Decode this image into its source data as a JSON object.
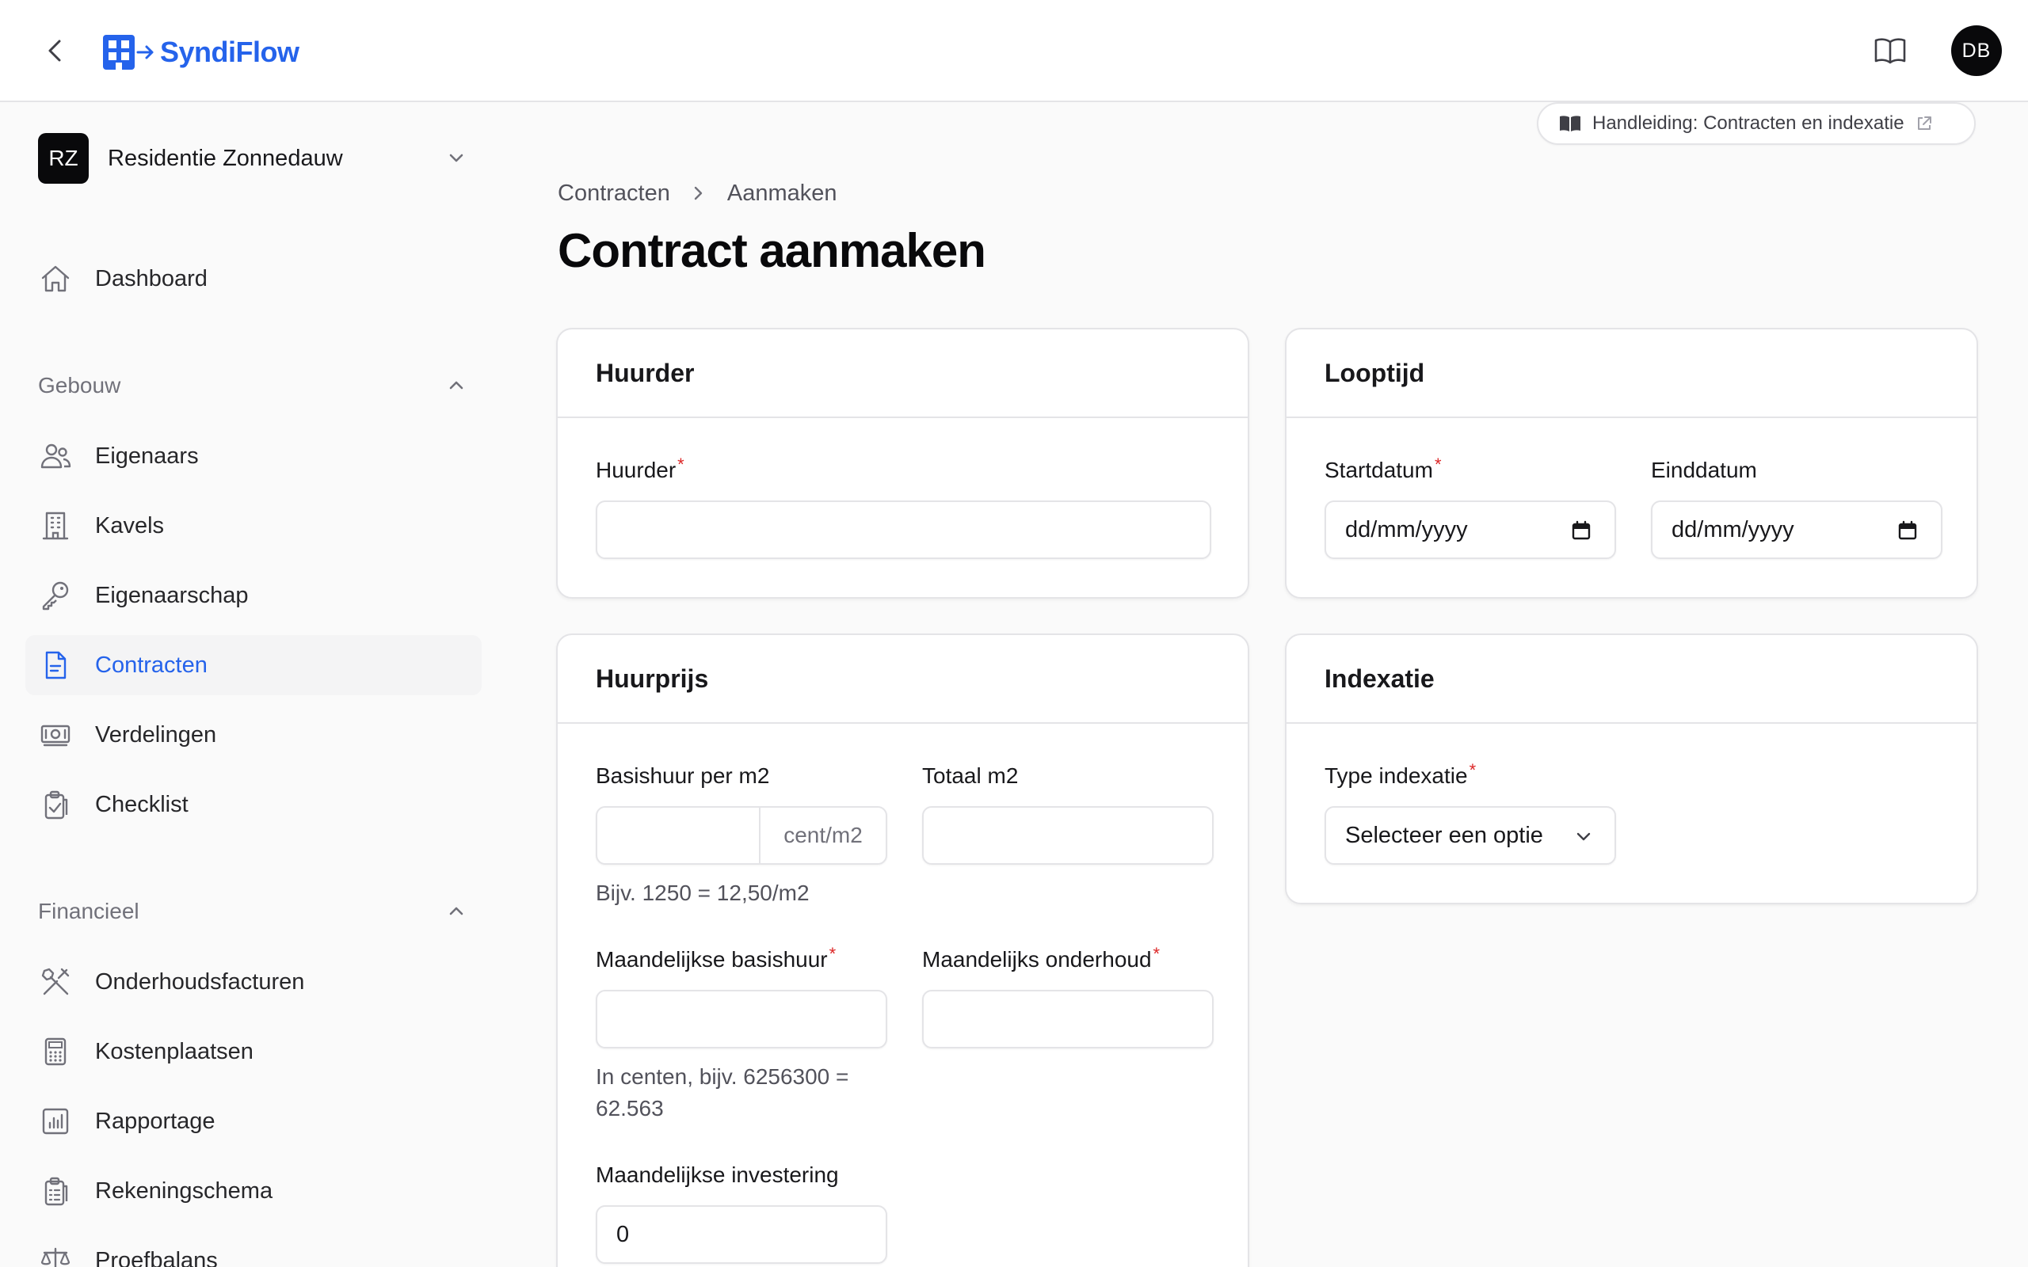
{
  "app": {
    "name": "SyndiFlow"
  },
  "user": {
    "initials": "DB"
  },
  "tenant": {
    "initials": "RZ",
    "name": "Residentie Zonnedauw"
  },
  "sidebar": {
    "top_items": [
      {
        "label": "Dashboard",
        "icon": "home-icon"
      }
    ],
    "sections": [
      {
        "title": "Gebouw",
        "expanded": true,
        "items": [
          {
            "label": "Eigenaars",
            "icon": "users-icon"
          },
          {
            "label": "Kavels",
            "icon": "building-icon"
          },
          {
            "label": "Eigenaarschap",
            "icon": "key-icon"
          },
          {
            "label": "Contracten",
            "icon": "document-icon",
            "active": true
          },
          {
            "label": "Verdelingen",
            "icon": "banknote-icon"
          },
          {
            "label": "Checklist",
            "icon": "clipboard-check-icon"
          }
        ]
      },
      {
        "title": "Financieel",
        "expanded": true,
        "items": [
          {
            "label": "Onderhoudsfacturen",
            "icon": "tools-icon"
          },
          {
            "label": "Kostenplaatsen",
            "icon": "calculator-icon"
          },
          {
            "label": "Rapportage",
            "icon": "chart-icon"
          },
          {
            "label": "Rekeningschema",
            "icon": "clipboard-list-icon"
          },
          {
            "label": "Proefbalans",
            "icon": "scale-icon"
          }
        ]
      }
    ]
  },
  "guide": {
    "label": "Handleiding: Contracten en indexatie"
  },
  "breadcrumb": {
    "parent": "Contracten",
    "current": "Aanmaken"
  },
  "page": {
    "title": "Contract aanmaken"
  },
  "cards": {
    "huurder": {
      "title": "Huurder",
      "field_label": "Huurder",
      "value": ""
    },
    "looptijd": {
      "title": "Looptijd",
      "start_label": "Startdatum",
      "start_placeholder": "dd/mm/yyyy",
      "end_label": "Einddatum",
      "end_placeholder": "dd/mm/yyyy"
    },
    "huurprijs": {
      "title": "Huurprijs",
      "basishuur_label": "Basishuur per m2",
      "basishuur_value": "",
      "basishuur_suffix": "cent/m2",
      "basishuur_hint": "Bijv. 1250 = 12,50/m2",
      "totaal_label": "Totaal m2",
      "totaal_value": "",
      "maand_basishuur_label": "Maandelijkse basishuur",
      "maand_basishuur_value": "",
      "maand_basishuur_hint": "In centen, bijv. 6256300 = 62.563",
      "maand_onderhoud_label": "Maandelijks onderhoud",
      "maand_onderhoud_value": "",
      "maand_investering_label": "Maandelijkse investering",
      "maand_investering_value": "0"
    },
    "indexatie": {
      "title": "Indexatie",
      "type_label": "Type indexatie",
      "type_value": "Selecteer een optie"
    }
  },
  "colors": {
    "accent": "#2563eb",
    "required": "#dc2626",
    "border": "#e4e4e7",
    "background": "#fafafa"
  }
}
